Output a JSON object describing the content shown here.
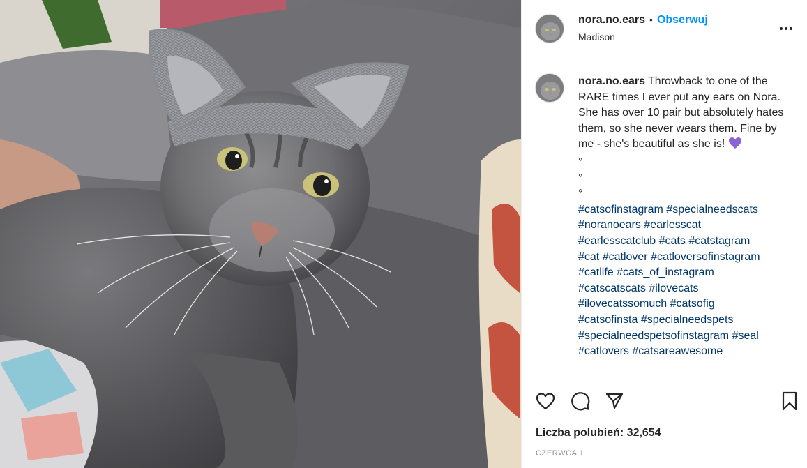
{
  "post": {
    "image_alt": "Gray tabby cat wearing knitted gray ears on a gray couch",
    "author": {
      "username": "nora.no.ears",
      "follow_label": "Obserwuj",
      "location": "Madison",
      "avatar_icon": "cat-avatar"
    },
    "more_icon": "more-options-icon",
    "caption": {
      "username": "nora.no.ears",
      "text": "Throwback to one of the RARE times I ever put any ears on Nora. She has over 10 pair but absolutely hates them, so she never wears them. Fine by me - she's beautiful as she is!",
      "dots": [
        "°",
        "°",
        "°"
      ],
      "hashtag_lines": [
        [
          "#catsofinstagram",
          "#specialneedscats"
        ],
        [
          "#noranoears",
          "#earlesscat"
        ],
        [
          "#earlesscatclub",
          "#cats",
          "#catstagram"
        ],
        [
          "#cat",
          "#catlover",
          "#catloversofinstagram"
        ],
        [
          "#catlife",
          "#cats_of_instagram"
        ],
        [
          "#catscatscats",
          "#ilovecats"
        ],
        [
          "#ilovecatssomuch",
          "#catsofig"
        ],
        [
          "#catsofinsta",
          "#specialneedspets"
        ],
        [
          "#specialneedspetsofinstagram",
          "#seal"
        ],
        [
          "#catlovers",
          "#catsareawesome"
        ]
      ]
    },
    "actions": {
      "like_icon": "heart-icon",
      "comment_icon": "comment-icon",
      "share_icon": "share-icon",
      "save_icon": "bookmark-icon"
    },
    "likes_label": "Liczba polubień: 32,654",
    "date_label": "CZERWCA 1"
  },
  "colors": {
    "link": "#0095f6",
    "hashtag": "#00376b",
    "text": "#262626",
    "muted": "#8e8e8e",
    "heart_emoji": "#8b63d9"
  }
}
